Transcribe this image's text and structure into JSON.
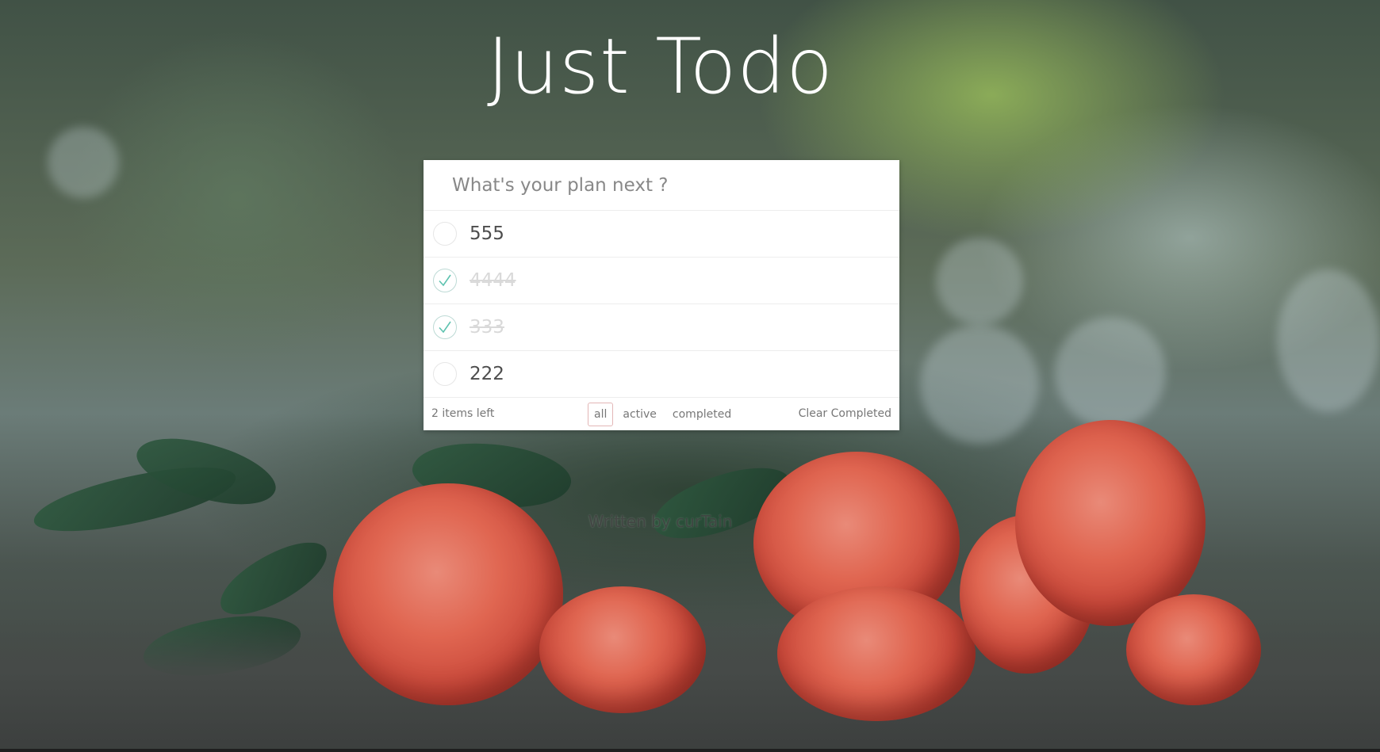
{
  "header": {
    "title": "Just Todo"
  },
  "new_todo": {
    "placeholder": "What's your plan next ?",
    "value": ""
  },
  "todos": [
    {
      "label": "555",
      "completed": false
    },
    {
      "label": "4444",
      "completed": true
    },
    {
      "label": "333",
      "completed": true
    },
    {
      "label": "222",
      "completed": false
    }
  ],
  "footer": {
    "items_left": "2 items left",
    "filters": {
      "all": "all",
      "active": "active",
      "completed": "completed"
    },
    "selected_filter": "all",
    "clear_completed": "Clear Completed"
  },
  "credit": "Written by curTain",
  "icons": {
    "check": "check-icon"
  },
  "colors": {
    "check": "#5dc2af",
    "selected_filter_border": "#d9a3a3"
  }
}
